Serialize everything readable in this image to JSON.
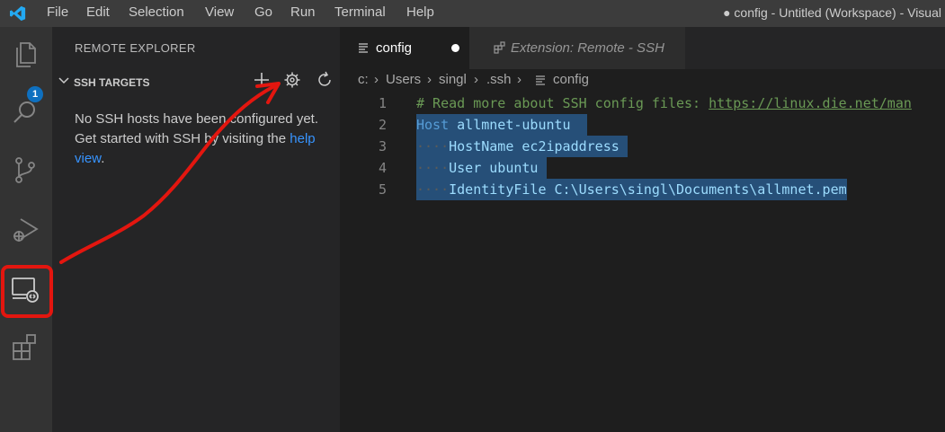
{
  "menubar": {
    "items": [
      "File",
      "Edit",
      "Selection",
      "View",
      "Go",
      "Run",
      "Terminal",
      "Help"
    ]
  },
  "window_title": "● config - Untitled (Workspace) - Visual",
  "activity_bar": {
    "explorer_badge": "1",
    "items": [
      "explorer-icon",
      "search-icon",
      "source-control-icon",
      "run-debug-icon",
      "remote-explorer-icon",
      "extensions-icon"
    ]
  },
  "sidebar": {
    "title": "REMOTE EXPLORER",
    "section_title": "SSH TARGETS",
    "message_text": "No SSH hosts have been configured yet. Get started with SSH by visiting the ",
    "message_link": "help view",
    "message_end": "."
  },
  "tabs": [
    {
      "label": "config",
      "dirty": true
    },
    {
      "label": "Extension: Remote - SSH"
    }
  ],
  "breadcrumb": [
    "c:",
    "Users",
    "singl",
    ".ssh",
    "config"
  ],
  "code_lines": [
    {
      "num": "1",
      "comment": "# Read more about SSH config files: ",
      "link": "https://linux.die.net/man"
    },
    {
      "num": "2",
      "keyword": "Host",
      "value": "allmnet-ubuntu"
    },
    {
      "num": "3",
      "keyword": "HostName",
      "value": "ec2ipaddress"
    },
    {
      "num": "4",
      "keyword": "User",
      "value": "ubuntu"
    },
    {
      "num": "5",
      "keyword": "IdentityFile",
      "value": "C:\\Users\\singl\\Documents\\allmnet.pem"
    }
  ],
  "colors": {
    "annotation": "#e3160f",
    "selection": "#264f78",
    "link": "#3794ff"
  }
}
